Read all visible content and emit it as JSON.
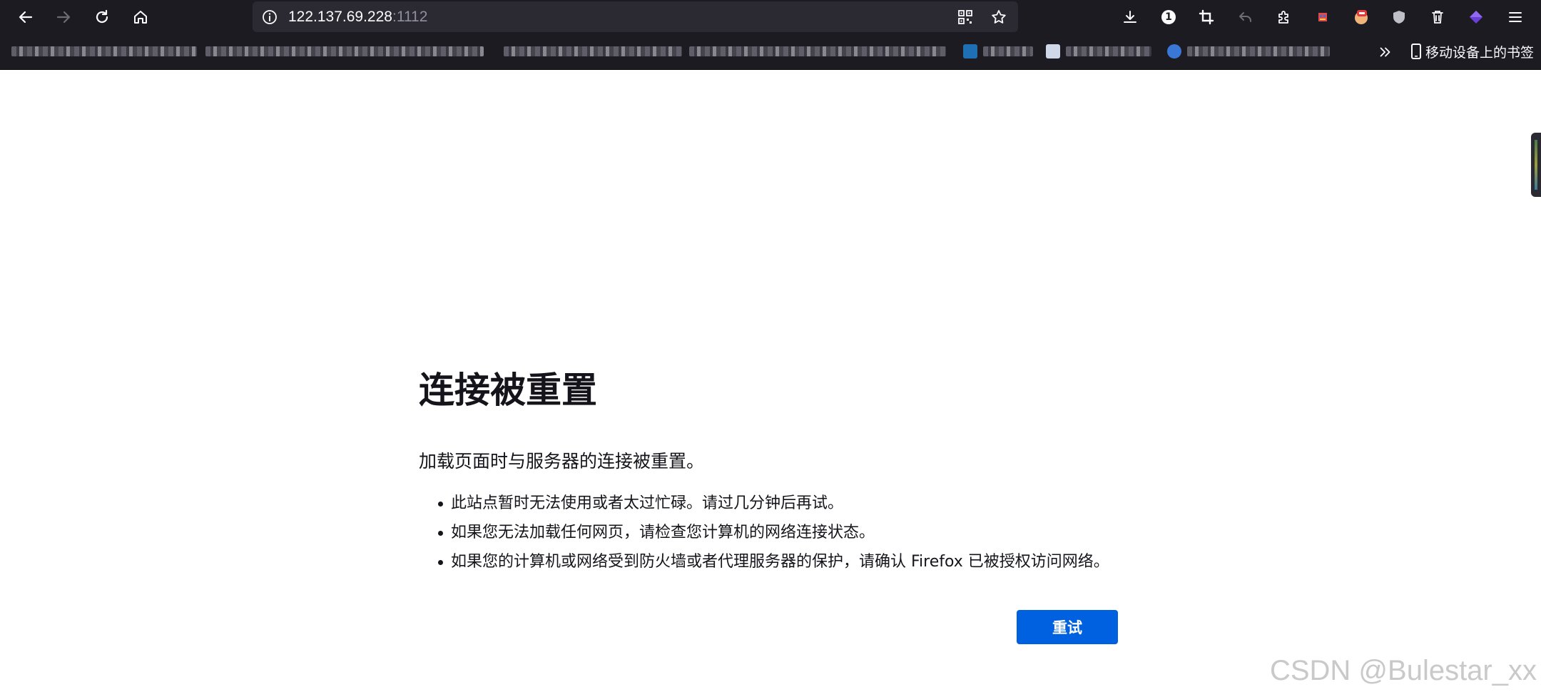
{
  "browser": {
    "url_host": "122.137.69.228",
    "url_port": ":1112",
    "extension_badge": "1",
    "mobile_bookmarks_label": "移动设备上的书签"
  },
  "error_page": {
    "title": "连接被重置",
    "description": "加载页面时与服务器的连接被重置。",
    "suggestions": [
      "此站点暂时无法使用或者太过忙碌。请过几分钟后再试。",
      "如果您无法加载任何网页，请检查您计算机的网络连接状态。",
      "如果您的计算机或网络受到防火墙或者代理服务器的保护，请确认 Firefox 已被授权访问网络。"
    ],
    "retry_label": "重试"
  },
  "watermark": "CSDN @Bulestar_xx",
  "colors": {
    "chrome_bg": "#1c1b22",
    "urlbar_bg": "#2b2a33",
    "primary_button": "#0061e0",
    "text": "#15141a"
  }
}
